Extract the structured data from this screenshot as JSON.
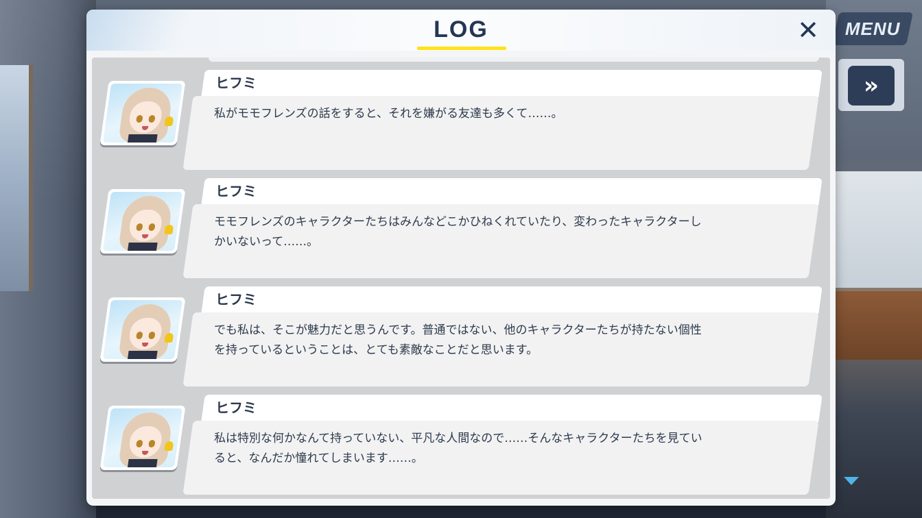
{
  "header": {
    "title": "LOG",
    "close_icon": "✕"
  },
  "hud": {
    "menu_label": "MENU",
    "fast_forward_icon": "»"
  },
  "entries": [
    {
      "speaker": "ヒフミ",
      "text": "私がモモフレンズの話をすると、それを嫌がる友達も多くて……。"
    },
    {
      "speaker": "ヒフミ",
      "text": "モモフレンズのキャラクターたちはみんなどこかひねくれていたり、変わったキャラクターし\nかいないって……。"
    },
    {
      "speaker": "ヒフミ",
      "text": "でも私は、そこが魅力だと思うんです。普通ではない、他のキャラクターたちが持たない個性\nを持っているということは、とても素敵なことだと思います。"
    },
    {
      "speaker": "ヒフミ",
      "text": "私は特別な何かなんて持っていない、平凡な人間なので……そんなキャラクターたちを見てい\nると、なんだか憧れてしまいます……。"
    }
  ],
  "colors": {
    "accent_yellow": "#ffe21a",
    "title_navy": "#233654",
    "scroll_arrow": "#4fb3e6"
  }
}
